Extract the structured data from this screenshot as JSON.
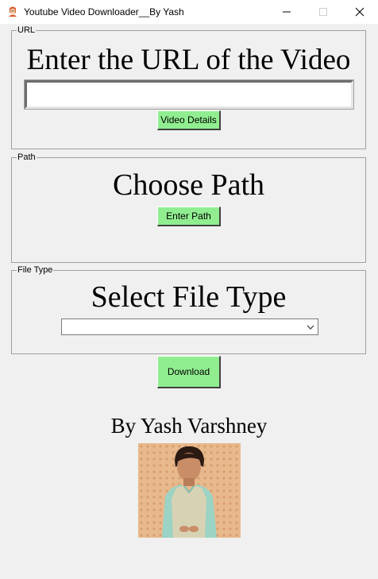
{
  "window": {
    "title": "Youtube Video Downloader__By Yash",
    "icon": "app-icon",
    "controls": [
      "minimize-icon",
      "maximize-icon",
      "close-icon"
    ]
  },
  "url_section": {
    "legend": "URL",
    "heading": "Enter the URL of the Video",
    "input_value": "",
    "button_label": "Video Details"
  },
  "path_section": {
    "legend": "Path",
    "heading": "Choose Path",
    "button_label": "Enter Path"
  },
  "filetype_section": {
    "legend": "File Type",
    "heading": "Select File Type",
    "selected_value": ""
  },
  "download": {
    "label": "Download"
  },
  "author": {
    "byline": "By Yash Varshney",
    "photo": "author-photo"
  },
  "colors": {
    "button_green": "#90ee90",
    "background": "#f0f0f0"
  }
}
